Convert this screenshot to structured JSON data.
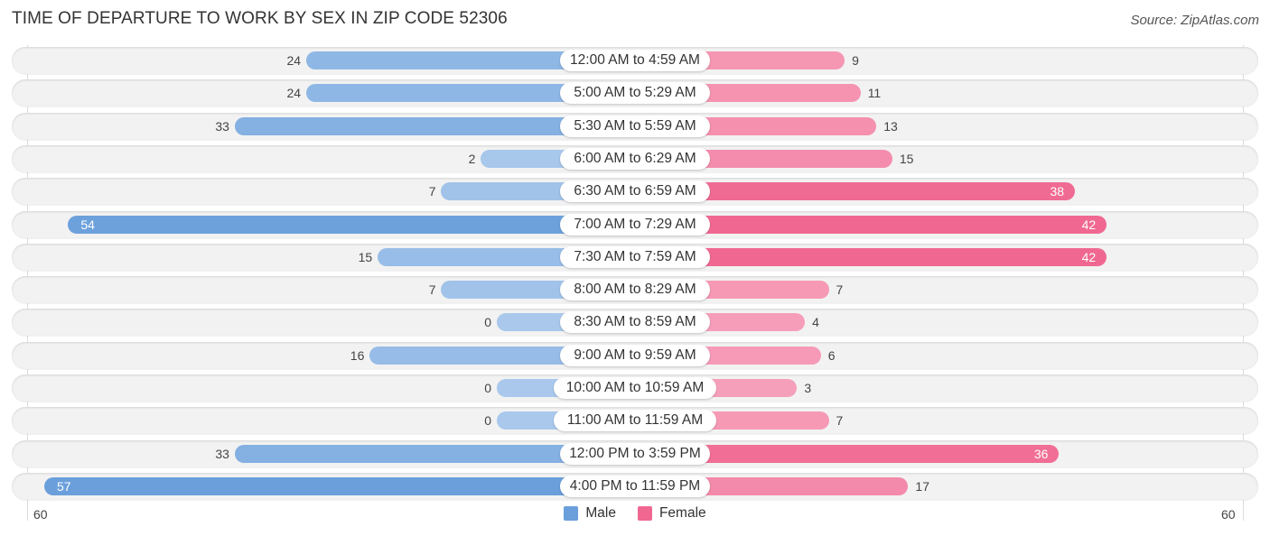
{
  "chart_data": {
    "type": "bar",
    "orientation": "horizontal-diverging",
    "title": "TIME OF DEPARTURE TO WORK BY SEX IN ZIP CODE 52306",
    "source": "Source: ZipAtlas.com",
    "categories": [
      "12:00 AM to 4:59 AM",
      "5:00 AM to 5:29 AM",
      "5:30 AM to 5:59 AM",
      "6:00 AM to 6:29 AM",
      "6:30 AM to 6:59 AM",
      "7:00 AM to 7:29 AM",
      "7:30 AM to 7:59 AM",
      "8:00 AM to 8:29 AM",
      "8:30 AM to 8:59 AM",
      "9:00 AM to 9:59 AM",
      "10:00 AM to 10:59 AM",
      "11:00 AM to 11:59 AM",
      "12:00 PM to 3:59 PM",
      "4:00 PM to 11:59 PM"
    ],
    "series": [
      {
        "name": "Male",
        "color": "#6a9fdb",
        "light_color": "#a9c8ec",
        "values": [
          24,
          24,
          33,
          2,
          7,
          54,
          15,
          7,
          0,
          16,
          0,
          0,
          33,
          57
        ]
      },
      {
        "name": "Female",
        "color": "#f06892",
        "light_color": "#f7a3bd",
        "values": [
          9,
          11,
          13,
          15,
          38,
          42,
          42,
          7,
          4,
          6,
          3,
          7,
          36,
          17
        ]
      }
    ],
    "axis": {
      "min_label": "60",
      "max_label": "60",
      "xlim": [
        -60,
        60
      ]
    },
    "legend": {
      "position": "bottom-center",
      "items": [
        "Male",
        "Female"
      ]
    },
    "grid": false
  }
}
